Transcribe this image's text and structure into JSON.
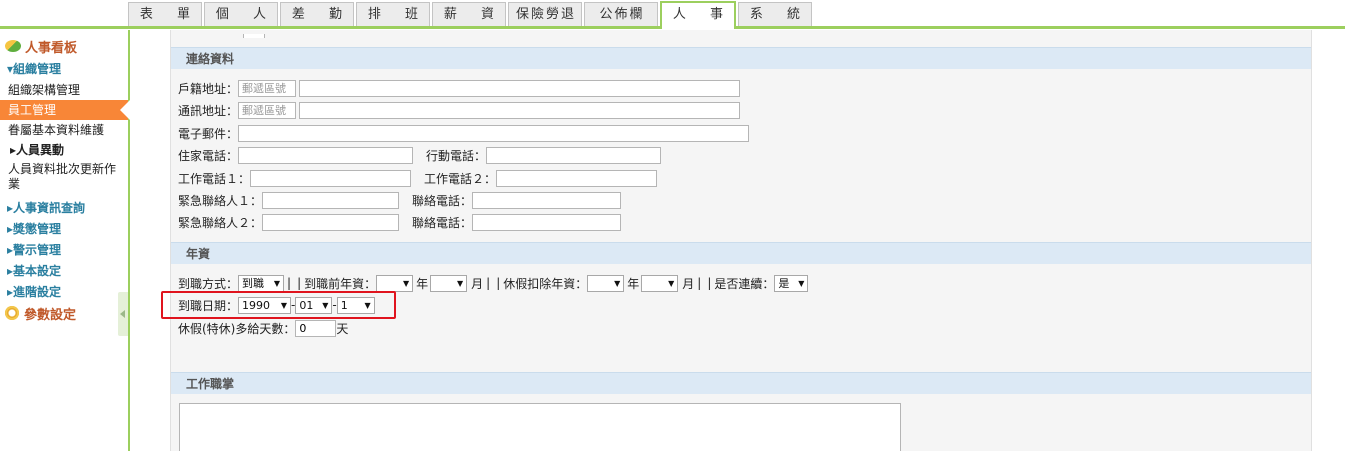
{
  "tabs": [
    {
      "label": "表 單"
    },
    {
      "label": "個 人"
    },
    {
      "label": "差 勤"
    },
    {
      "label": "排 班"
    },
    {
      "label": "薪 資"
    },
    {
      "label": "保險勞退"
    },
    {
      "label": "公佈欄"
    },
    {
      "label": "人 事"
    },
    {
      "label": "系 統"
    }
  ],
  "sidebar": {
    "header": "人事看板",
    "org_group": "▾組織管理",
    "org_item": "組織架構管理",
    "emp_item": "員工管理",
    "family_item": "眷屬基本資料維護",
    "change_sub": "▸人員異動",
    "batch_item": "人員資料批次更新作業",
    "query_group": "▸人事資訊查詢",
    "reward_group": "▸獎懲管理",
    "notice_group": "▸警示管理",
    "basic_group": "▸基本設定",
    "advanced_group": "▸進階設定",
    "params": "參數設定"
  },
  "contact": {
    "title": "連絡資料",
    "home_addr_label": "戶籍地址：",
    "mail_addr_label": "通訊地址：",
    "zip_placeholder": "郵遞區號",
    "email_label": "電子郵件：",
    "home_phone_label": "住家電話：",
    "mobile_label": "行動電話：",
    "work1_label": "工作電話１：",
    "work2_label": "工作電話２：",
    "emerg1_label": "緊急聯絡人１：",
    "emerg2_label": "緊急聯絡人２：",
    "emerg_phone_label": "聯絡電話："
  },
  "seniority": {
    "title": "年資",
    "arrival_mode_label": "到職方式：",
    "arrival_mode_value": "到職",
    "pre_seniority_label": "到職前年資：",
    "year_unit": "年",
    "month_unit": "月",
    "leave_deduct_label": "休假扣除年資：",
    "continuous_label": "是否連續：",
    "continuous_value": "是",
    "divider": "|",
    "arrival_date_label": "到職日期：",
    "arrival_year": "1990",
    "arrival_month": "01",
    "arrival_day": "1",
    "date_sep": "-",
    "extra_days_label": "休假(特休)多給天數：",
    "extra_days_value": "0",
    "day_unit": "天"
  },
  "duty": {
    "title": "工作職掌"
  }
}
